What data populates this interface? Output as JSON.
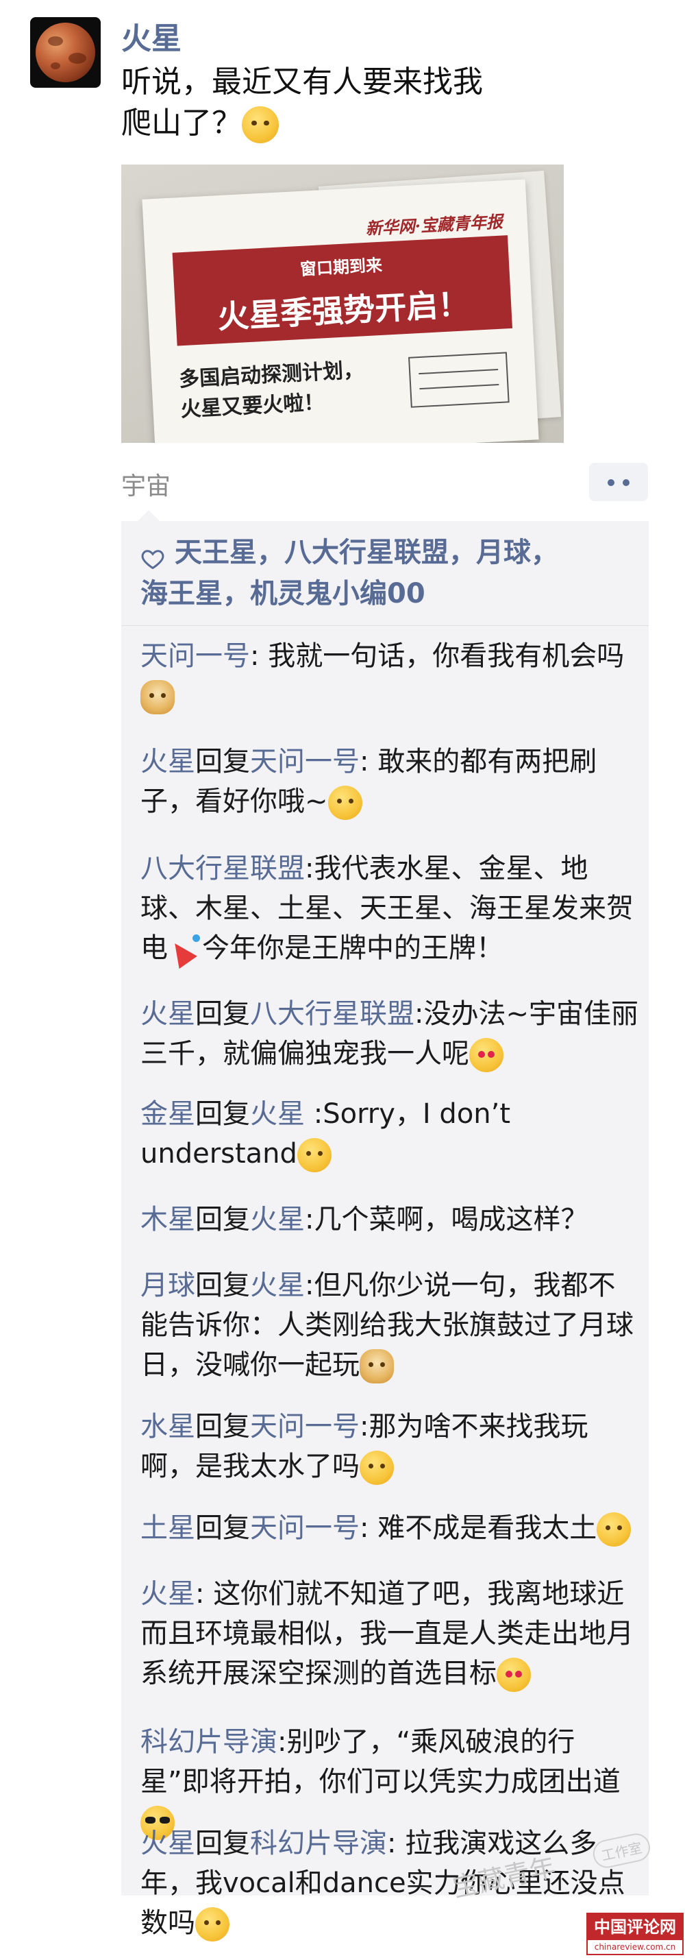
{
  "post": {
    "author": "火星",
    "text_line1": "听说，最近又有人要来找我",
    "text_line2": "爬山了？",
    "location": "宇宙"
  },
  "news_image": {
    "masthead": "新华网·宝藏青年报",
    "banner_small": "窗口期到来",
    "banner_big": "火星季强势开启！",
    "sub_line1": "多国启动探测计划，",
    "sub_line2": "火星又要火啦！"
  },
  "likes": {
    "text_line1": "天王星，八大行星联盟，月球，",
    "text_line2": "海王星，机灵鬼小编00"
  },
  "comments": [
    {
      "nick": "天问一号",
      "sep": ": ",
      "text": "我就一句话，你看我有机会吗"
    },
    {
      "nick": "火星",
      "reply_word": "回复",
      "reply_to": "天问一号",
      "sep": ": ",
      "text": "敢来的都有两把刷子，看好你哦~"
    },
    {
      "nick": "八大行星联盟",
      "sep": ":",
      "text": "我代表水星、金星、地球、木星、土星、天王星、海王星发来贺电",
      "text2": "今年你是王牌中的王牌！"
    },
    {
      "nick": "火星",
      "reply_word": "回复",
      "reply_to": "八大行星联盟",
      "sep": ":",
      "text": "没办法~宇宙佳丽三千，就偏偏独宠我一人呢"
    },
    {
      "nick": "金星",
      "reply_word": "回复",
      "reply_to": "火星",
      "sep": " :",
      "text": "Sorry，I don’t understand"
    },
    {
      "nick": "木星",
      "reply_word": "回复",
      "reply_to": "火星",
      "sep": ":",
      "text": "几个菜啊，喝成这样？"
    },
    {
      "nick": "月球",
      "reply_word": "回复",
      "reply_to": "火星",
      "sep": ":",
      "text": "但凡你少说一句，我都不能告诉你：人类刚给我大张旗鼓过了月球日，没喊你一起玩"
    },
    {
      "nick": "水星",
      "reply_word": "回复",
      "reply_to": "天问一号",
      "sep": ":",
      "text": "那为啥不来找我玩啊，是我太水了吗"
    },
    {
      "nick": "土星",
      "reply_word": "回复",
      "reply_to": "天问一号",
      "sep": ": ",
      "text": "难不成是看我太土"
    },
    {
      "nick": "火星",
      "sep": ": ",
      "text": "这你们就不知道了吧，我离地球近而且环境最相似，我一直是人类走出地月系统开展深空探测的首选目标"
    },
    {
      "nick": "科幻片导演",
      "sep": ":",
      "text": "别吵了，“乘风破浪的行星”即将开拍，你们可以凭实力成团出道"
    },
    {
      "nick": "火星",
      "reply_word": "回复",
      "reply_to": "科幻片导演",
      "sep": ": ",
      "text": "拉我演戏这么多年，我vocal和dance实力你心里还没点数吗"
    }
  ],
  "watermark": {
    "text": "宝藏青年",
    "stamp": "工作室"
  },
  "source_logo": {
    "top": "中国评论网",
    "bottom": "chinareview.com.cn"
  },
  "colors": {
    "nick": "#576b95",
    "panel": "#f3f3f5",
    "logo_red": "#c0282b"
  }
}
